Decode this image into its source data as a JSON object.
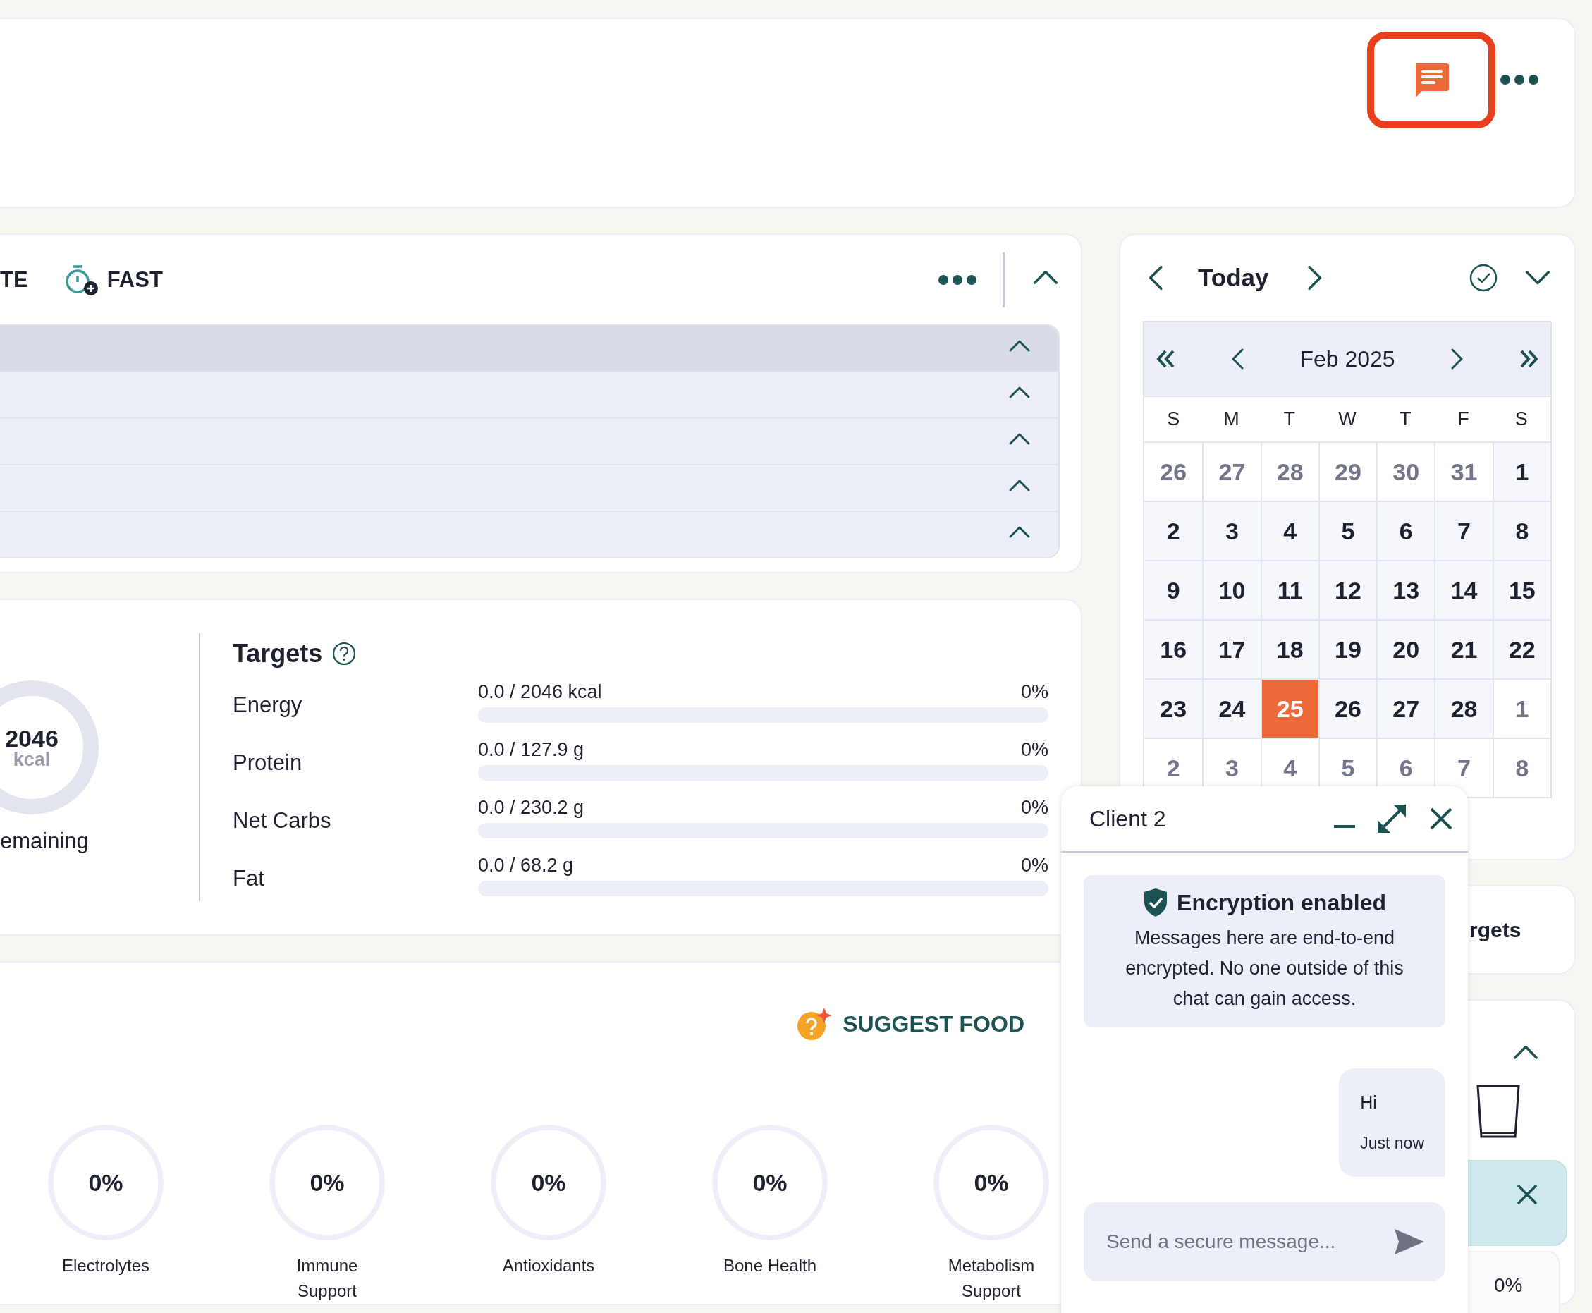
{
  "top_bar": {
    "chat_button": {
      "highlighted": true
    }
  },
  "meal_panel": {
    "actions": [
      {
        "label": "TE",
        "kind": "text"
      },
      {
        "label": "FAST",
        "kind": "timer"
      }
    ],
    "expanded": true,
    "sections": [
      {
        "kind": "header",
        "expanded": true
      },
      {
        "kind": "meal",
        "expanded": true
      },
      {
        "kind": "meal",
        "expanded": true
      },
      {
        "kind": "meal",
        "expanded": true
      },
      {
        "kind": "meal",
        "expanded": true
      }
    ]
  },
  "energy_summary": {
    "value": "2046",
    "unit": "kcal",
    "caption": "emaining",
    "level": 0
  },
  "targets": {
    "title": "Targets",
    "rows": [
      {
        "label": "Energy",
        "reading": "0.0 / 2046 kcal",
        "percent": "0%",
        "level": 0
      },
      {
        "label": "Protein",
        "reading": "0.0 / 127.9 g",
        "percent": "0%",
        "level": 0
      },
      {
        "label": "Net Carbs",
        "reading": "0.0 / 230.2 g",
        "percent": "0%",
        "level": 0
      },
      {
        "label": "Fat",
        "reading": "0.0 / 68.2 g",
        "percent": "0%",
        "level": 0
      }
    ]
  },
  "suggest_food": {
    "label": "SUGGEST FOOD"
  },
  "nutrient_scores": [
    {
      "label": "Electrolytes",
      "value": "0%",
      "level": 0
    },
    {
      "label": "Immune Support",
      "value": "0%",
      "level": 0
    },
    {
      "label": "Antioxidants",
      "value": "0%",
      "level": 0
    },
    {
      "label": "Bone Health",
      "value": "0%",
      "level": 0
    },
    {
      "label": "Metabolism Support",
      "value": "0%",
      "level": 0
    }
  ],
  "calendar": {
    "title": "Today",
    "expanded": false,
    "month": "Feb 2025",
    "weekdays": [
      "S",
      "M",
      "T",
      "W",
      "T",
      "F",
      "S"
    ],
    "weeks": [
      [
        {
          "day": "26",
          "outside_month": true,
          "selected": false
        },
        {
          "day": "27",
          "outside_month": true,
          "selected": false
        },
        {
          "day": "28",
          "outside_month": true,
          "selected": false
        },
        {
          "day": "29",
          "outside_month": true,
          "selected": false
        },
        {
          "day": "30",
          "outside_month": true,
          "selected": false
        },
        {
          "day": "31",
          "outside_month": true,
          "selected": false
        },
        {
          "day": "1",
          "outside_month": false,
          "selected": false
        }
      ],
      [
        {
          "day": "2",
          "outside_month": false,
          "selected": false
        },
        {
          "day": "3",
          "outside_month": false,
          "selected": false
        },
        {
          "day": "4",
          "outside_month": false,
          "selected": false
        },
        {
          "day": "5",
          "outside_month": false,
          "selected": false
        },
        {
          "day": "6",
          "outside_month": false,
          "selected": false
        },
        {
          "day": "7",
          "outside_month": false,
          "selected": false
        },
        {
          "day": "8",
          "outside_month": false,
          "selected": false
        }
      ],
      [
        {
          "day": "9",
          "outside_month": false,
          "selected": false
        },
        {
          "day": "10",
          "outside_month": false,
          "selected": false
        },
        {
          "day": "11",
          "outside_month": false,
          "selected": false
        },
        {
          "day": "12",
          "outside_month": false,
          "selected": false
        },
        {
          "day": "13",
          "outside_month": false,
          "selected": false
        },
        {
          "day": "14",
          "outside_month": false,
          "selected": false
        },
        {
          "day": "15",
          "outside_month": false,
          "selected": false
        }
      ],
      [
        {
          "day": "16",
          "outside_month": false,
          "selected": false
        },
        {
          "day": "17",
          "outside_month": false,
          "selected": false
        },
        {
          "day": "18",
          "outside_month": false,
          "selected": false
        },
        {
          "day": "19",
          "outside_month": false,
          "selected": false
        },
        {
          "day": "20",
          "outside_month": false,
          "selected": false
        },
        {
          "day": "21",
          "outside_month": false,
          "selected": false
        },
        {
          "day": "22",
          "outside_month": false,
          "selected": false
        }
      ],
      [
        {
          "day": "23",
          "outside_month": false,
          "selected": false
        },
        {
          "day": "24",
          "outside_month": false,
          "selected": false
        },
        {
          "day": "25",
          "outside_month": false,
          "selected": true
        },
        {
          "day": "26",
          "outside_month": false,
          "selected": false
        },
        {
          "day": "27",
          "outside_month": false,
          "selected": false
        },
        {
          "day": "28",
          "outside_month": false,
          "selected": false
        },
        {
          "day": "1",
          "outside_month": true,
          "selected": false
        }
      ],
      [
        {
          "day": "2",
          "outside_month": true,
          "selected": false
        },
        {
          "day": "3",
          "outside_month": true,
          "selected": false
        },
        {
          "day": "4",
          "outside_month": true,
          "selected": false
        },
        {
          "day": "5",
          "outside_month": true,
          "selected": false
        },
        {
          "day": "6",
          "outside_month": true,
          "selected": false
        },
        {
          "day": "7",
          "outside_month": true,
          "selected": false
        },
        {
          "day": "8",
          "outside_month": true,
          "selected": false
        }
      ]
    ]
  },
  "targets_card": {
    "label": "rgets"
  },
  "water_card": {
    "expanded": true,
    "percent": "0%"
  },
  "chat": {
    "title": "Client 2",
    "encryption": {
      "title": "Encryption enabled",
      "text": "Messages here are end-to-end encrypted. No one outside of this chat can gain access."
    },
    "messages": [
      {
        "text": "Hi",
        "time": "Just now"
      }
    ],
    "input": {
      "placeholder": "Send a secure message..."
    }
  }
}
